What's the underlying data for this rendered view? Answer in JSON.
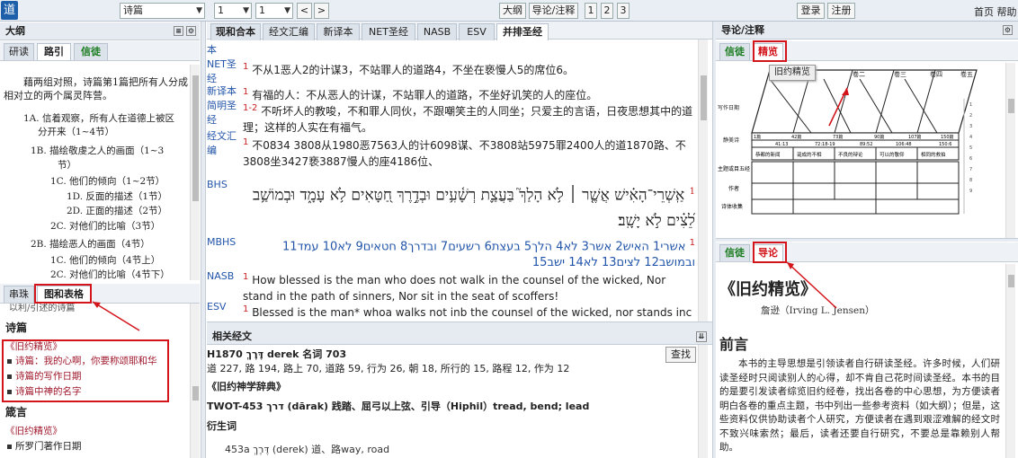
{
  "toolbar": {
    "logo": "道",
    "book": "诗篇",
    "chapter": "1",
    "verse": "1",
    "prev": "<",
    "next": ">",
    "outline_btn": "大纲",
    "guide_btn": "导论/注释",
    "cols": [
      "1",
      "2",
      "3"
    ],
    "login": "登录",
    "register": "注册",
    "home_help": "首页 帮助"
  },
  "left": {
    "title": "大纲",
    "tabs": [
      "研读",
      "路引",
      "信徒"
    ],
    "intro": "藉两组对照，诗篇第1篇把所有人分成相对立的两个属灵阵营。",
    "items": [
      "1A. 信着观察，所有人在道德上被区",
      "分开来（1~4节）",
      "1B. 描绘敬虔之人的画面（1~3",
      "节）",
      "1C. 他们的倾向（1~2节）",
      "1D. 反面的描述（1节）",
      "2D. 正面的描述（2节）",
      "2C. 对他们的比喻（3节）",
      "2B. 描绘恶人的画面（4节）",
      "1C. 他们的倾向（4节上）",
      "2C. 对他们的比喻（4节下）"
    ],
    "bottom_tabs": [
      "串珠",
      "图和表格"
    ],
    "cut_line": "以利/引述的诗篇",
    "book_title": "诗篇",
    "ref_title": "《旧约精览》",
    "ref_items": [
      "诗篇：我的心啊，你要称颂耶和华",
      "诗篇的写作日期",
      "诗篇中神的名字"
    ],
    "book2": "箴言",
    "ref2_title": "《旧约精览》",
    "ref2_items": [
      "所罗门著作日期"
    ]
  },
  "versions": {
    "tabs": [
      "现和合本",
      "经文汇编",
      "新译本",
      "NET圣经",
      "NASB",
      "ESV",
      "并排圣经"
    ],
    "rows": [
      {
        "label": "本",
        "num": "",
        "text": ""
      },
      {
        "label": "NET圣经",
        "num": "1",
        "text": "不从1恶人2的计谋3，不站罪人的道路4，不坐在亵慢人5的席位6。"
      },
      {
        "label": "新译本",
        "num": "1",
        "text": "有福的人：不从恶人的计谋，不站罪人的道路，不坐好讥笑的人的座位。"
      },
      {
        "label": "简明圣经",
        "num": "1-2",
        "text": "不听坏人的教唆，不和罪人同伙，不跟嘲笑主的人同坐；只爱主的言语，日夜思想其中的道理；这样的人实在有福气。"
      },
      {
        "label": "经文汇编",
        "num": "1",
        "text": "不0834 3808从1980恶7563人的计6098谋、不3808站5975罪2400人的道1870路、不3808坐3427亵3887慢人的座4186位、"
      },
      {
        "label": "BHS",
        "num": "1",
        "text": "אַֽשְׁרֵי־הָאִ֗ישׁ אֲשֶׁ֤ר ׀ לֹ֥א הָלַךְ֮ בַּעֲצַ֪ת רְשָׁ֫עִ֥ים וּבְדֶ֣רֶךְ חַ֭טָּאִים לֹ֥א עָמָ֑ד וּבְמוֹשַׁ֥ב לֵ֝צִ֗ים לֹ֣א יָשָֽׁב׃"
      },
      {
        "label": "MBHS",
        "num": "1",
        "text": "אשרי1 האיש2 אשר3 לא4 הלך5 בעצת6 רשעים7 ובדרך8 חטאים9 לא10 עמד11 ובמושב12 לצים13 לא14 ישב15"
      },
      {
        "label": "NASB",
        "num": "1",
        "text": "How blessed is the man who does not walk in the counsel of the wicked, Nor stand in the path of sinners, Nor sit in the seat of scoffers!"
      },
      {
        "label": "ESV",
        "num": "1",
        "text": "Blessed is the man* whoa walks not inb the counsel of the wicked, nor stands inc the way of"
      }
    ]
  },
  "lexicon": {
    "title": "相关经文",
    "search": "查找",
    "line1": "H1870 דֶּרֶךְ derek 名词 703",
    "line2": "道 227, 路 194, 路上 70, 道路 59, 行为 26, 朝 18, 所行的 15, 路程 12, 作为 12",
    "book": "《旧约神学辞典》",
    "twot": "TWOT-453        דרך (dārak) 践踏、屈弓以上弦、引导（Hiphil）tread, bend; lead",
    "deriv": "衍生词",
    "entry": "453a      דֶּרֶךְ (derek) 道、路way, road"
  },
  "right": {
    "title": "导论/注释",
    "tabs1": [
      "信徒",
      "精览"
    ],
    "tooltip": "旧约精览",
    "tabs2": [
      "信徒",
      "导论"
    ],
    "book_title": "《旧约精览》",
    "author": "詹逊（Irving L. Jensen）",
    "heading": "前言",
    "body": "本书的主导思想是引领读者自行研读圣经。许多时候，人们研读圣经时只阅读别人的心得，却不肯自己花时间读圣经。本书的目的是要引发读者综览旧约经卷，找出各卷的中心思想，为方便读者明白各卷的重点主题，书中列出一些参考资料（如大纲）；但是，这些资料仅供协助读者个人研究，方便读者在遇到艰涩难解的经文时不致兴味索然；最后，读者还要自行研究，不要总是靠赖别人帮助。",
    "chart": {
      "cols": [
        "一",
        "卷二",
        "卷三",
        "卷四",
        "卷五"
      ],
      "rowlabels": [
        "写作日期",
        "静美诗",
        "主题或目五经",
        "作者",
        "诗体收集"
      ],
      "cells": [
        "恭都的新闻",
        "诞成的不相",
        "不良的辩论",
        "可以的敬仰",
        "相同的救拍"
      ],
      "refs": [
        "1篇",
        "42篇",
        "73篇",
        "90篇",
        "107篇",
        "150篇"
      ],
      "nums": [
        "41:13",
        "72:18-19",
        "89:52",
        "106:48",
        "150:6"
      ]
    }
  },
  "colors": {
    "red": "#d3141b",
    "green": "#197b1e",
    "blue": "#2255aa",
    "verse": "#c81e1e"
  }
}
